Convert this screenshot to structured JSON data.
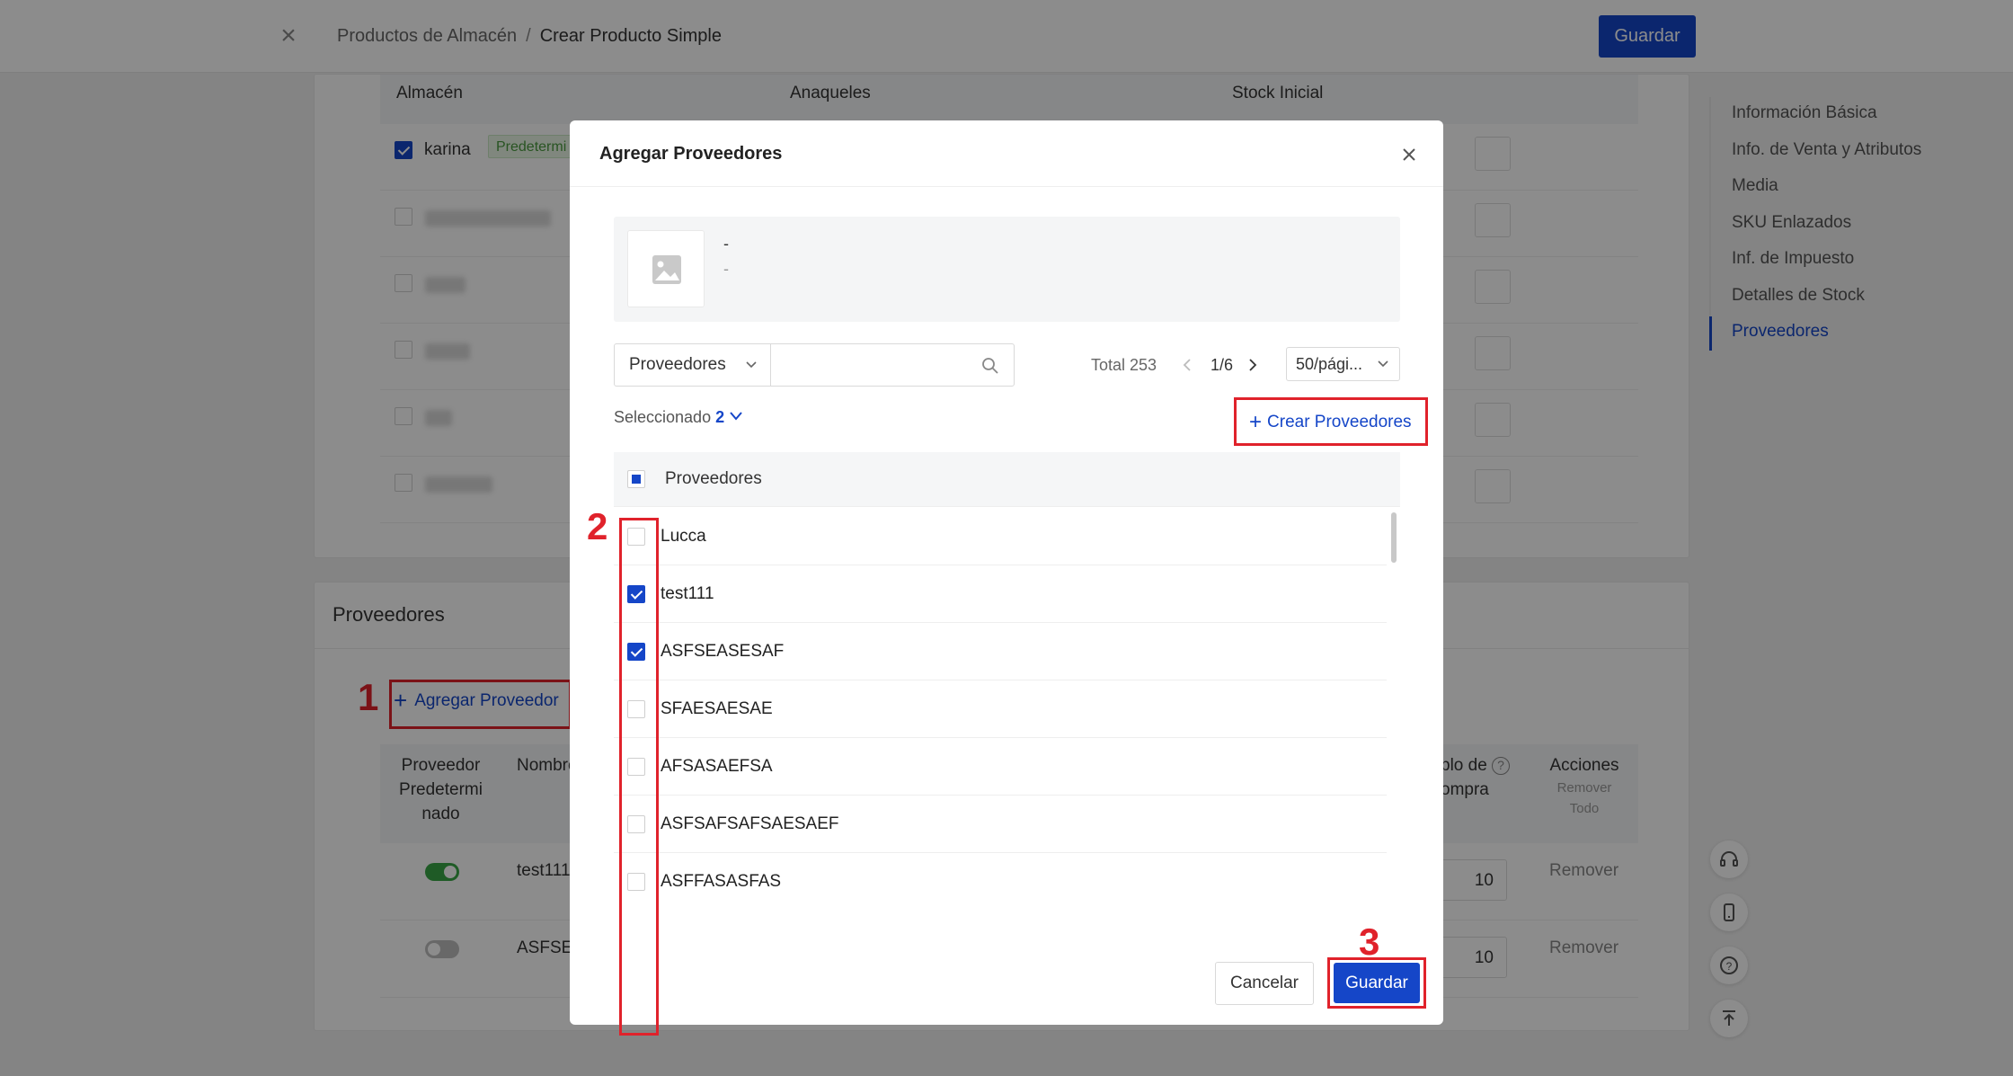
{
  "header": {
    "breadcrumb_parent": "Productos de Almacén",
    "breadcrumb_separator": "/",
    "breadcrumb_current": "Crear Producto Simple",
    "save_label": "Guardar"
  },
  "warehouse_table": {
    "columns": [
      "Almacén",
      "Anaqueles",
      "Stock Inicial"
    ],
    "first_row": {
      "name": "karina",
      "tag": "Predetermi",
      "checked": true
    }
  },
  "suppliers_section": {
    "title": "Proveedores",
    "add_label": "Agregar Proveedor",
    "columns": {
      "default": "Proveedor\nPredetermi\nnado",
      "name": "Nombre",
      "multiple": "plo de",
      "multiple_2": "ompra",
      "actions": "Acciones",
      "remove_all_1": "Remover",
      "remove_all_2": "Todo"
    },
    "rows": [
      {
        "name": "test111",
        "default": true,
        "qty": "10",
        "action": "Remover"
      },
      {
        "name": "ASFSE",
        "default": false,
        "qty": "10",
        "action": "Remover"
      }
    ]
  },
  "anchor_nav": {
    "items": [
      "Información Básica",
      "Info. de Venta y Atributos",
      "Media",
      "SKU Enlazados",
      "Inf. de Impuesto",
      "Detalles de Stock",
      "Proveedores"
    ],
    "active": "Proveedores"
  },
  "modal": {
    "title": "Agregar Proveedores",
    "product_name": "-",
    "product_sub": "-",
    "filter_select": "Proveedores",
    "search_placeholder": "",
    "total": "Total 253",
    "page": "1/6",
    "page_size": "50/pági...",
    "selected_label": "Seleccionado",
    "selected_count": "2",
    "create_label": "Crear Proveedores",
    "list_header": "Proveedores",
    "items": [
      {
        "name": "Lucca",
        "checked": false
      },
      {
        "name": "test111",
        "checked": true
      },
      {
        "name": "ASFSEASESAF",
        "checked": true
      },
      {
        "name": "SFAESAESAE",
        "checked": false
      },
      {
        "name": "AFSASAEFSA",
        "checked": false
      },
      {
        "name": "ASFSAFSAFSAESAEF",
        "checked": false
      },
      {
        "name": "ASFFASASFAS",
        "checked": false
      }
    ],
    "cancel_label": "Cancelar",
    "save_label": "Guardar"
  },
  "annotations": {
    "step1": "1",
    "step2": "2",
    "step3": "3"
  },
  "colors": {
    "primary": "#1546c8",
    "annotation": "#e0222b",
    "toggle_on": "#3aa746"
  }
}
